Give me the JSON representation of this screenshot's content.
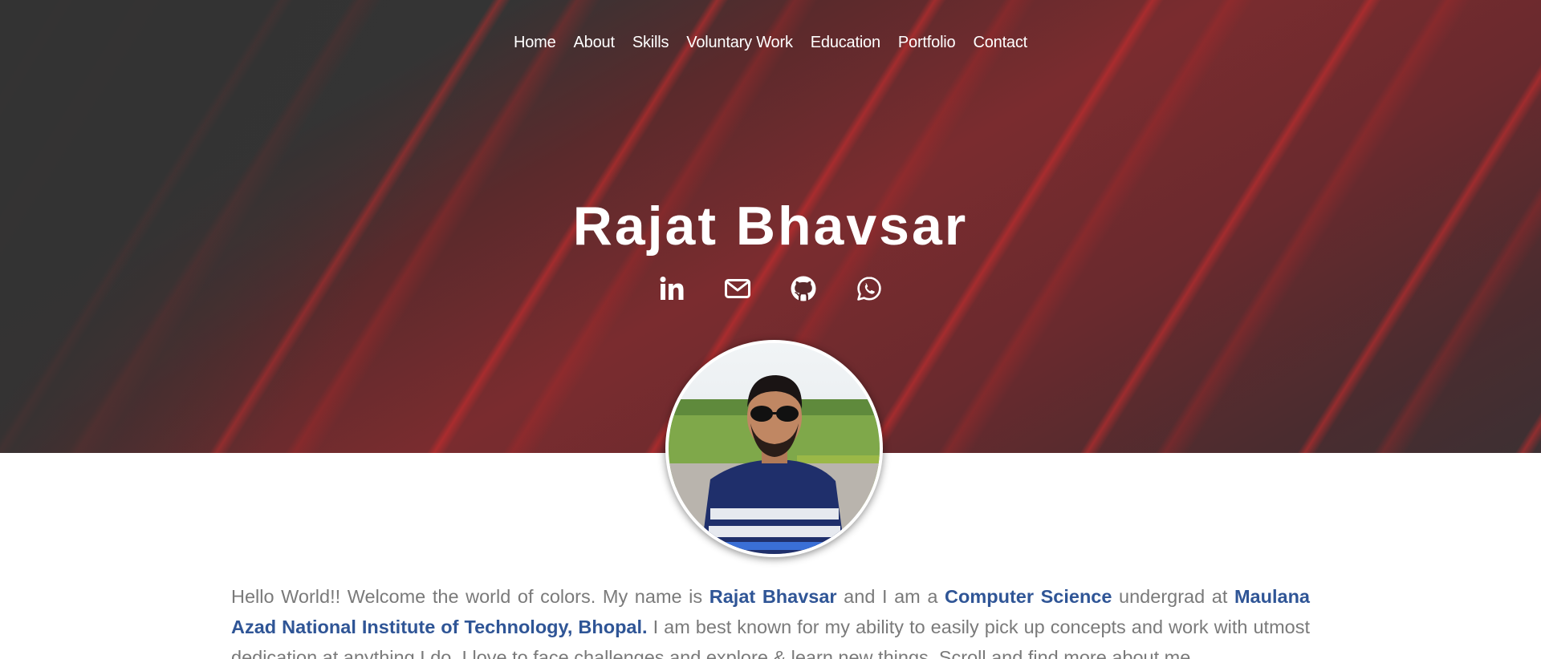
{
  "nav": {
    "items": [
      "Home",
      "About",
      "Skills",
      "Voluntary Work",
      "Education",
      "Portfolio",
      "Contact"
    ]
  },
  "hero": {
    "name": "Rajat Bhavsar",
    "social": [
      "linkedin-icon",
      "mail-icon",
      "github-icon",
      "whatsapp-icon"
    ]
  },
  "intro": {
    "p1": "Hello World!! Welcome the world of colors. My name is ",
    "b1": "Rajat Bhavsar",
    "p2": " and I am a ",
    "b2": "Computer Science",
    "p3": " undergrad at ",
    "b3": "Maulana Azad National Institute of Technology, Bhopal.",
    "p4": " I am best known for my ability to easily pick up concepts and work with utmost dedication at anything I do. I love to face challenges and explore & learn new things. Scroll and find more about me"
  },
  "colors": {
    "accent": "#2f5596",
    "hero_dark": "#333333",
    "hero_red": "#7a2c2f"
  }
}
